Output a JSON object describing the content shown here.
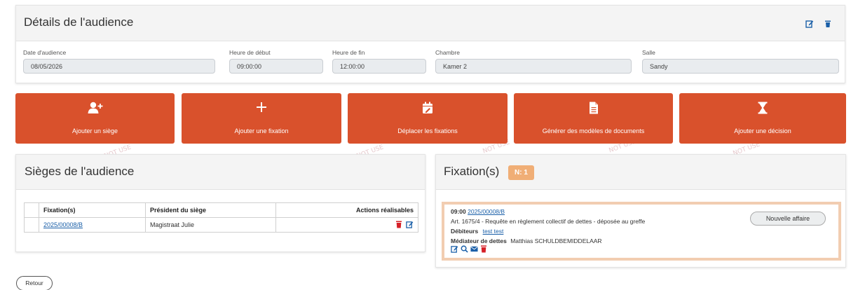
{
  "details": {
    "title": "Détails de l'audience",
    "fields": [
      {
        "label": "Date d'audience",
        "value": "08/05/2026"
      },
      {
        "label": "Heure de début",
        "value": "09:00:00"
      },
      {
        "label": "Heure de fin",
        "value": "12:00:00"
      },
      {
        "label": "Chambre",
        "value": "Kamer 2"
      },
      {
        "label": "Salle",
        "value": "Sandy"
      }
    ]
  },
  "actions": [
    {
      "label": "Ajouter un siège",
      "icon": "user-plus-icon"
    },
    {
      "label": "Ajouter une fixation",
      "icon": "plus-icon"
    },
    {
      "label": "Déplacer les fixations",
      "icon": "calendar-edit-icon"
    },
    {
      "label": "Générer des modèles de documents",
      "icon": "file-icon"
    },
    {
      "label": "Ajouter une décision",
      "icon": "hourglass-icon"
    }
  ],
  "sieges": {
    "title": "Sièges de l'audience",
    "columns": [
      "Fixation(s)",
      "Président du siège",
      "Actions réalisables"
    ],
    "rows": [
      {
        "fixation": "2025/00008/B",
        "president": "Magistraat Julie"
      }
    ]
  },
  "fixations": {
    "title": "Fixation(s)",
    "count_badge": "N: 1",
    "item": {
      "time": "09:00",
      "case_number": "2025/00008/B",
      "description": "Art. 1675/4 - Requête en règlement collectif de dettes - déposée au greffe",
      "debtors_label": "Débiteurs",
      "debtors_value": "test test",
      "mediator_label": "Médiateur de dettes",
      "mediator_value": "Matthias SCHULDBEMIDDELAAR",
      "tag": "Nouvelle affaire"
    }
  },
  "watermarks": [
    "NOT USE"
  ],
  "retour_label": "Retour",
  "colors": {
    "accent": "#d9512c",
    "link": "#1a5fa8",
    "badge": "#f0ae76",
    "delete": "#d62027"
  }
}
